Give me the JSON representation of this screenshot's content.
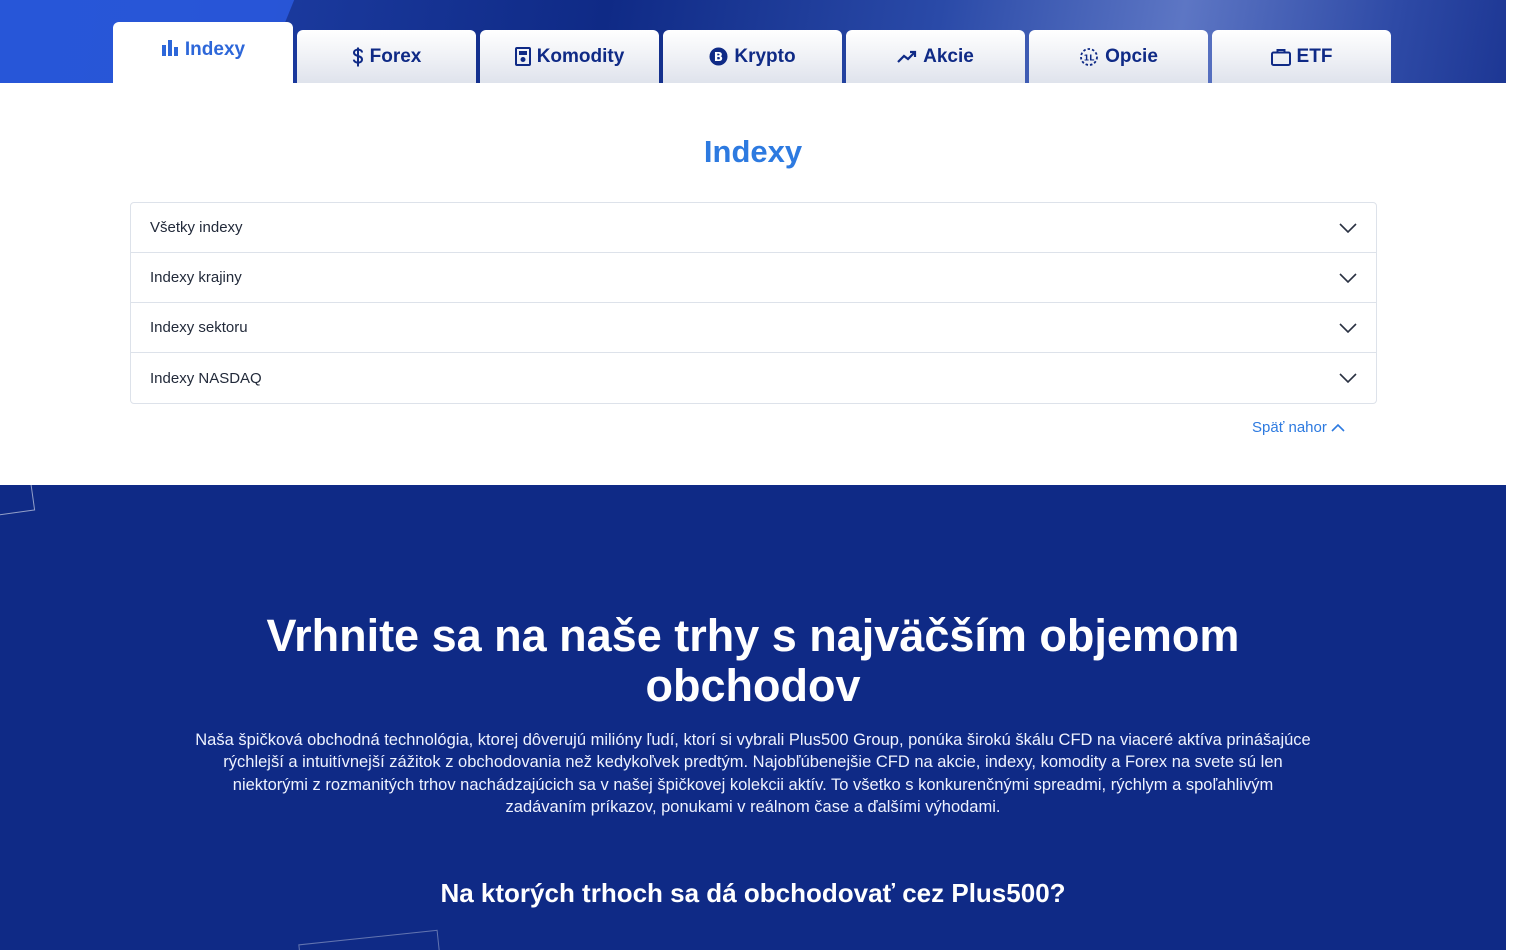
{
  "tabs": [
    {
      "label": "Indexy",
      "icon": "bar-chart-icon",
      "active": true
    },
    {
      "label": "Forex",
      "icon": "dollar-icon",
      "active": false
    },
    {
      "label": "Komodity",
      "icon": "commodity-icon",
      "active": false
    },
    {
      "label": "Krypto",
      "icon": "bitcoin-icon",
      "active": false
    },
    {
      "label": "Akcie",
      "icon": "trend-up-icon",
      "active": false
    },
    {
      "label": "Opcie",
      "icon": "options-icon",
      "active": false
    },
    {
      "label": "ETF",
      "icon": "briefcase-icon",
      "active": false
    }
  ],
  "section": {
    "title": "Indexy",
    "accordion": [
      {
        "label": "Všetky indexy"
      },
      {
        "label": "Indexy krajiny"
      },
      {
        "label": "Indexy sektoru"
      },
      {
        "label": "Indexy NASDAQ"
      }
    ],
    "back_to_top": "Späť nahor"
  },
  "promo": {
    "heading": "Vrhnite sa na naše trhy s najväčším objemom obchodov",
    "body": "Naša špičková obchodná technológia, ktorej dôverujú milióny ľudí, ktorí si vybrali Plus500 Group, ponúka širokú škálu CFD na viaceré aktíva prinášajúce rýchlejší a intuitívnejší zážitok z obchodovania než kedykoľvek predtým. Najobľúbenejšie CFD na akcie, indexy, komodity a Forex na svete sú len niektorými z rozmanitých trhov nachádzajúcich sa v našej špičkovej kolekcii aktív. To všetko s konkurenčnými spreadmi, rýchlym a spoľahlivým zadávaním príkazov, ponukami v reálnom čase a ďalšími výhodami.",
    "subheading": "Na ktorých trhoch sa dá obchodovať cez Plus500?"
  },
  "colors": {
    "brand_dark": "#0f2a86",
    "accent_blue": "#2d7ae0",
    "tab_text": "#0f2a86"
  }
}
